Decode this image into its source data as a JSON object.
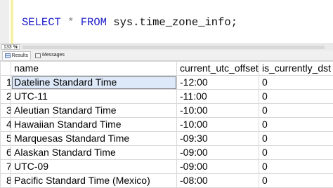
{
  "editor": {
    "tokens": {
      "select": "SELECT",
      "star": "*",
      "from": "FROM",
      "table": "sys.time_zone_info;"
    }
  },
  "zoom": {
    "value": "133 %"
  },
  "tabs": [
    {
      "label": "Results",
      "active": true
    },
    {
      "label": "Messages",
      "active": false
    }
  ],
  "grid": {
    "columns": [
      "name",
      "current_utc_offset",
      "is_currently_dst"
    ],
    "rows": [
      {
        "n": "1",
        "name": "Dateline Standard Time",
        "offset": "-12:00",
        "dst": "0"
      },
      {
        "n": "2",
        "name": "UTC-11",
        "offset": "-11:00",
        "dst": "0"
      },
      {
        "n": "3",
        "name": "Aleutian Standard Time",
        "offset": "-10:00",
        "dst": "0"
      },
      {
        "n": "4",
        "name": "Hawaiian Standard Time",
        "offset": "-10:00",
        "dst": "0"
      },
      {
        "n": "5",
        "name": "Marquesas Standard Time",
        "offset": "-09:30",
        "dst": "0"
      },
      {
        "n": "6",
        "name": "Alaskan Standard Time",
        "offset": "-09:00",
        "dst": "0"
      },
      {
        "n": "7",
        "name": "UTC-09",
        "offset": "-09:00",
        "dst": "0"
      },
      {
        "n": "8",
        "name": "Pacific Standard Time (Mexico)",
        "offset": "-08:00",
        "dst": "0"
      }
    ]
  }
}
